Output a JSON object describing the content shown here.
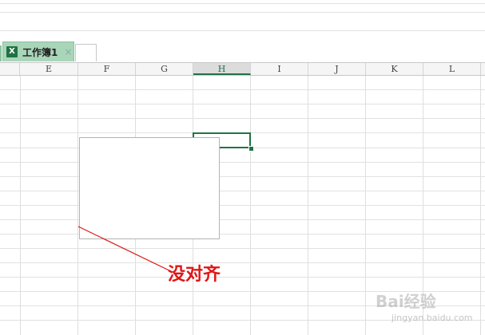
{
  "tab_bar": {
    "workbook_tab": {
      "label": "工作簿1",
      "icon": "excel-file-icon",
      "close_glyph": "×"
    }
  },
  "columns": [
    {
      "label": "E",
      "active": false
    },
    {
      "label": "F",
      "active": false
    },
    {
      "label": "G",
      "active": false
    },
    {
      "label": "H",
      "active": true
    },
    {
      "label": "I",
      "active": false
    },
    {
      "label": "J",
      "active": false
    },
    {
      "label": "K",
      "active": false
    },
    {
      "label": "L",
      "active": false
    }
  ],
  "annotation": {
    "text": "没对齐",
    "color": "#e01515"
  },
  "watermark": {
    "brand": "Bai经验",
    "url": "jingyan.baidu.com"
  },
  "colors": {
    "accent": "#217346",
    "tab_bg": "#a9d5b9"
  }
}
